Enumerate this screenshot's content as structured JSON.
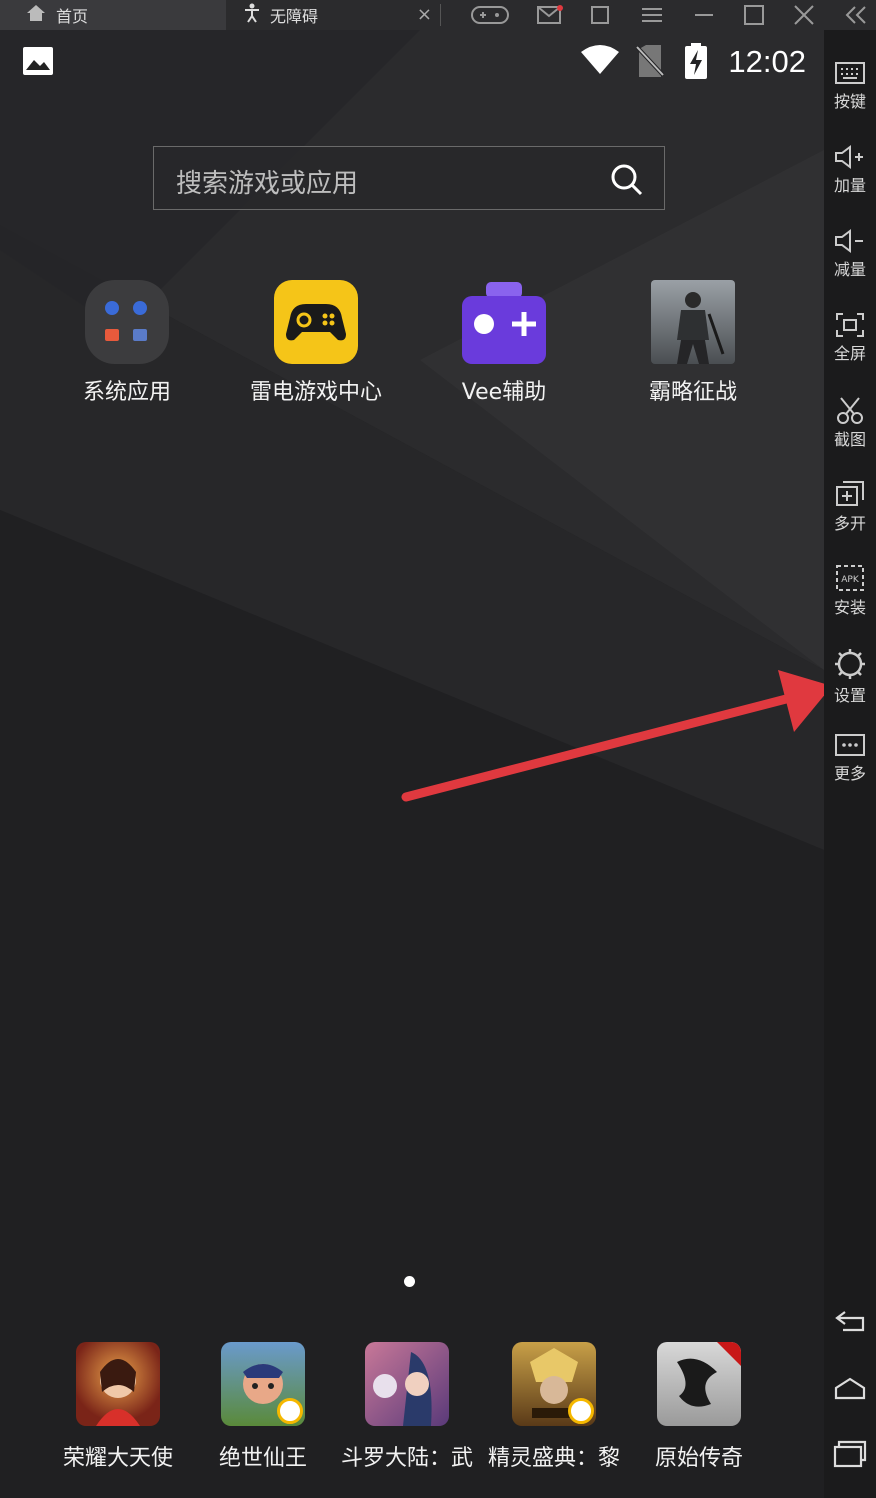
{
  "tabs": [
    {
      "label": "首页"
    },
    {
      "label": "无障碍"
    }
  ],
  "status": {
    "time": "12:02"
  },
  "search": {
    "placeholder": "搜索游戏或应用"
  },
  "apps": [
    {
      "label": "系统应用",
      "icon": "folder-icon"
    },
    {
      "label": "雷电游戏中心",
      "icon": "gamepad-icon",
      "color": "#f5c518"
    },
    {
      "label": "Vee辅助",
      "icon": "vee-gamepad-icon",
      "color": "#6a3bdc"
    },
    {
      "label": "霸略征战",
      "icon": "game-cover-icon"
    }
  ],
  "dock": [
    {
      "label": "荣耀大天使"
    },
    {
      "label": "绝世仙王"
    },
    {
      "label": "斗罗大陆：武"
    },
    {
      "label": "精灵盛典：黎"
    },
    {
      "label": "原始传奇"
    }
  ],
  "sidebar": [
    {
      "label": "按键",
      "icon": "keyboard-icon"
    },
    {
      "label": "加量",
      "icon": "volume-up-icon"
    },
    {
      "label": "减量",
      "icon": "volume-down-icon"
    },
    {
      "label": "全屏",
      "icon": "fullscreen-icon"
    },
    {
      "label": "截图",
      "icon": "scissors-icon"
    },
    {
      "label": "多开",
      "icon": "multi-instance-icon"
    },
    {
      "label": "安装",
      "icon": "apk-install-icon"
    },
    {
      "label": "设置",
      "icon": "gear-icon"
    },
    {
      "label": "更多",
      "icon": "more-icon"
    }
  ],
  "colors": {
    "annotation_arrow": "#e0393f",
    "accent_yellow": "#f5c518",
    "accent_purple": "#6a3bdc"
  }
}
